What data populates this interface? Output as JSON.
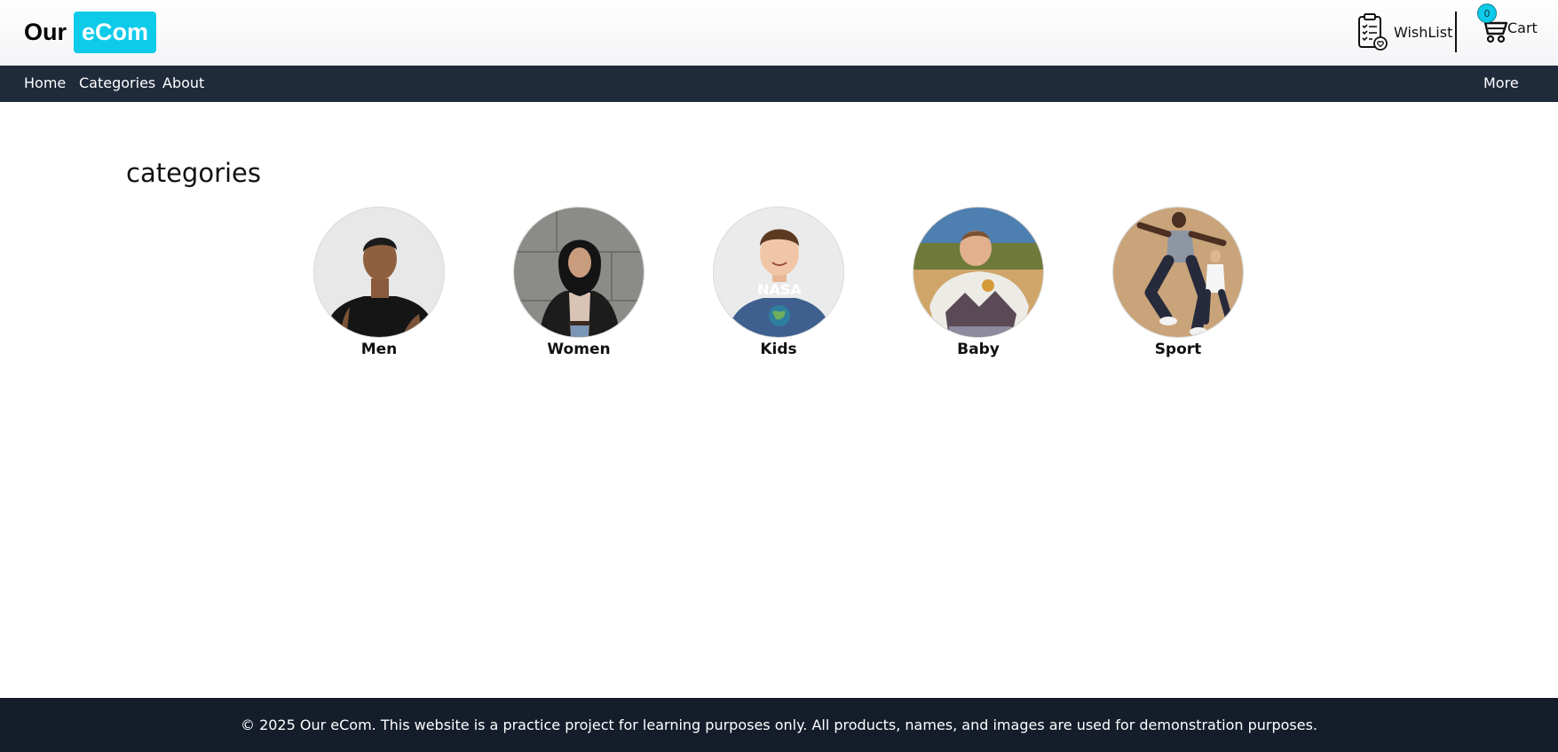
{
  "header": {
    "logo_part1": "Our",
    "logo_part2": "eCom",
    "wishlist_label": "WishList",
    "cart_label": "Cart",
    "cart_count": "0",
    "accent_color": "#0fcbea"
  },
  "nav": {
    "items": [
      {
        "label": "Home"
      },
      {
        "label": "Categories"
      },
      {
        "label": "About"
      }
    ],
    "more_label": "More",
    "background": "#1f2a3b"
  },
  "main": {
    "section_title": "categories",
    "categories": [
      {
        "label": "Men",
        "icon": "men-category-image"
      },
      {
        "label": "Women",
        "icon": "women-category-image"
      },
      {
        "label": "Kids",
        "icon": "kids-category-image"
      },
      {
        "label": "Baby",
        "icon": "baby-category-image"
      },
      {
        "label": "Sport",
        "icon": "sport-category-image"
      }
    ]
  },
  "footer": {
    "text": "© 2025 Our eCom. This website is a practice project for learning purposes only. All products, names, and images are used for demonstration purposes."
  }
}
